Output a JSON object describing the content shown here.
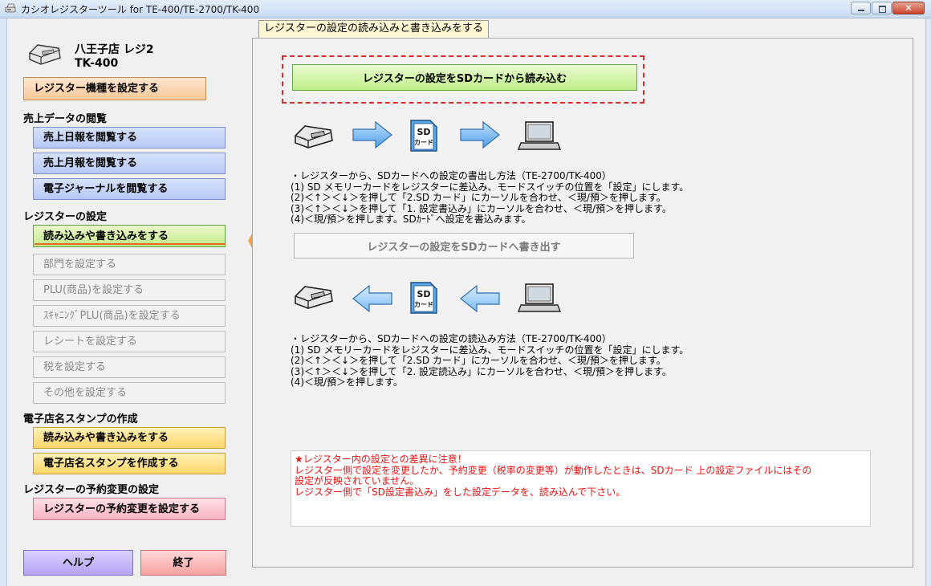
{
  "window": {
    "title": "カシオレジスターツール for TE-400/TE-2700/TK-400",
    "min_label": "",
    "max_label": "",
    "close_label": "✕"
  },
  "sidebar": {
    "shop_name": "八王子店 レジ2",
    "model": "TK-400",
    "set_model_button": "レジスター機種を設定する",
    "sections": {
      "sales": "売上データの閲覧",
      "register": "レジスターの設定",
      "stamp": "電子店名スタンプの作成",
      "reservation": "レジスターの予約変更の設定"
    },
    "sales_buttons": [
      "売上日報を閲覧する",
      "売上月報を閲覧する",
      "電子ジャーナルを閲覧する"
    ],
    "register_buttons": [
      "読み込みや書き込みをする",
      "部門を設定する",
      "PLU(商品)を設定する",
      "ｽｷｬﾆﾝｸﾞPLU(商品)を設定する",
      "レシートを設定する",
      "税を設定する",
      "その他を設定する"
    ],
    "stamp_buttons": [
      "読み込みや書き込みをする",
      "電子店名スタンプを作成する"
    ],
    "reservation_button": "レジスターの予約変更を設定する",
    "help_button": "ヘルプ",
    "exit_button": "終了"
  },
  "main": {
    "tab_label": "レジスターの設定の読み込みと書き込みをする",
    "read_button": "レジスターの設定をSDカードから読み込む",
    "write_button": "レジスターの設定をSDカードへ書き出す",
    "sd_label_top": "SD",
    "sd_label_bottom": "カード",
    "read_instructions": [
      "・レジスターから、SDカードへの設定の書出し方法（TE-2700/TK-400）",
      "(1) SD メモリーカードをレジスターに差込み、モードスイッチの位置を「設定」にします。",
      "(2)＜↑＞＜↓＞を押して「2.SD カード」にカーソルを合わせ、＜現/預＞を押します。",
      "(3)＜↑＞＜↓＞を押して「1. 設定書込み」にカーソルを合わせ、＜現/預＞を押します。",
      "(4)＜現/預＞を押します。SDｶｰﾄﾞへ設定を書込みます。"
    ],
    "write_instructions": [
      "・レジスターから、SDカードへの設定の読込み方法（TE-2700/TK-400）",
      "(1) SD メモリーカードをレジスターに差込み、モードスイッチの位置を「設定」にします。",
      "(2)＜↑＞＜↓＞を押して「2.SD カード」にカーソルを合わせ、＜現/預＞を押します。",
      "(3)＜↑＞＜↓＞を押して「2. 設定読込み」にカーソルを合わせ、＜現/預＞を押します。",
      "(4)＜現/預＞を押します。"
    ],
    "notice": [
      "★レジスター内の設定との差異に注意！",
      "レジスター側で設定を変更したか、予約変更（税率の変更等）が動作したときは、SDカード 上の設定ファイルにはその",
      "設定が反映されていません。",
      "レジスター側で「SD設定書込み」をした設定データを、読み込んで下さい。"
    ]
  },
  "colors": {
    "accent_orange": "#f4a24a",
    "notice_red": "#ee1111",
    "dash_red": "#e02b2b",
    "arrow_blue": "#5aa6ea"
  },
  "icons": [
    "app-icon",
    "register-icon",
    "right-arrow-icon",
    "sd-card-icon",
    "laptop-icon",
    "left-arrow-icon"
  ]
}
